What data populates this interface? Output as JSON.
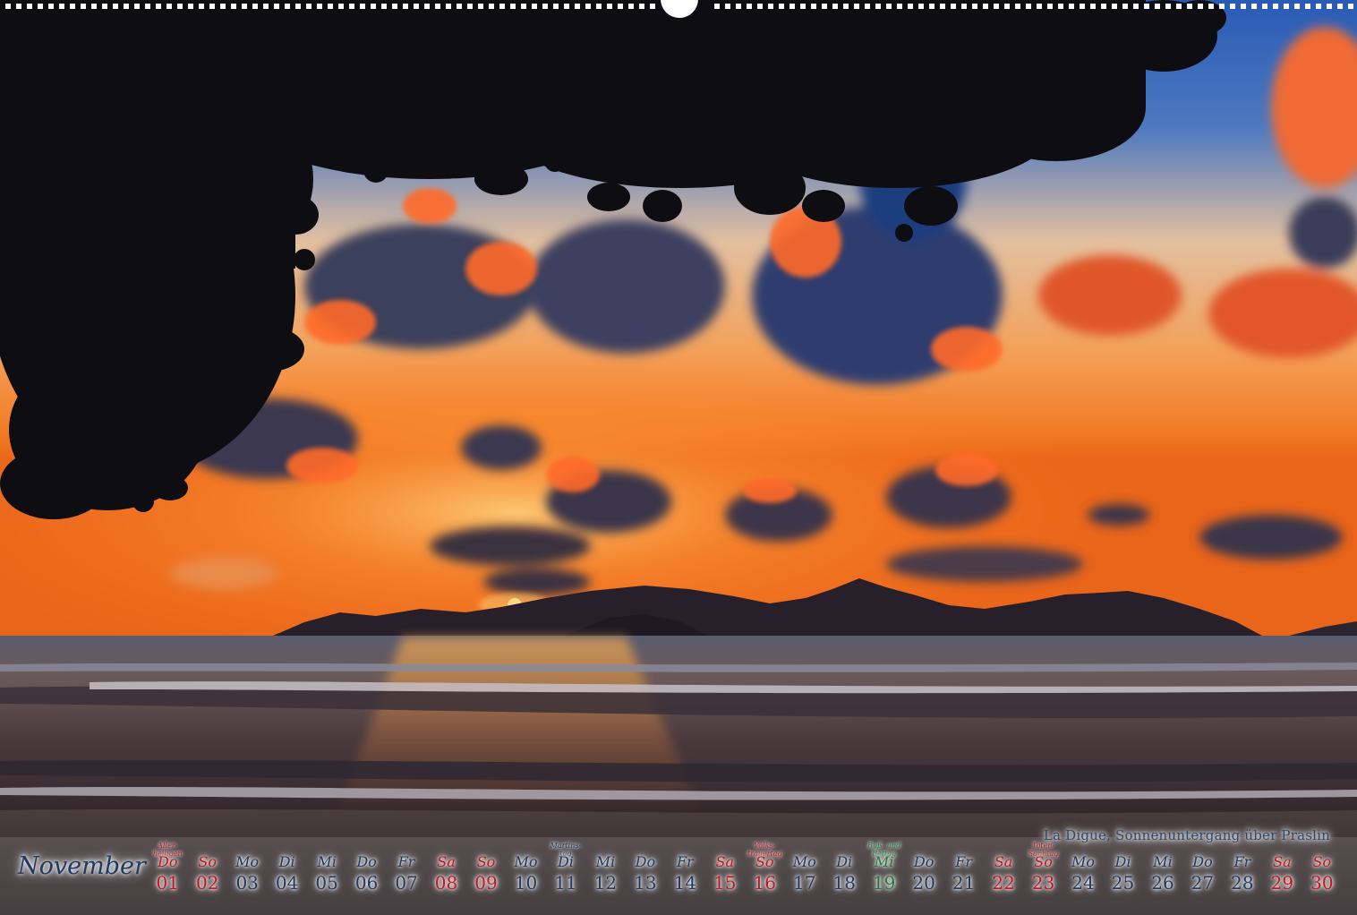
{
  "caption": "La Digue, Sonnenuntergang über Praslin",
  "month": "November",
  "colors": {
    "weekday": "#1f3a63",
    "holiday": "#c8141e",
    "observance": "#1c7a3a"
  },
  "days": [
    {
      "wd": "Do",
      "num": "01",
      "hol": "Aller-\nheiligen",
      "type": "red"
    },
    {
      "wd": "So",
      "num": "02",
      "hol": "",
      "type": "red"
    },
    {
      "wd": "Mo",
      "num": "03",
      "hol": "",
      "type": "blue"
    },
    {
      "wd": "Di",
      "num": "04",
      "hol": "",
      "type": "blue"
    },
    {
      "wd": "Mi",
      "num": "05",
      "hol": "",
      "type": "blue"
    },
    {
      "wd": "Do",
      "num": "06",
      "hol": "",
      "type": "blue"
    },
    {
      "wd": "Fr",
      "num": "07",
      "hol": "",
      "type": "blue"
    },
    {
      "wd": "Sa",
      "num": "08",
      "hol": "",
      "type": "red"
    },
    {
      "wd": "So",
      "num": "09",
      "hol": "",
      "type": "red"
    },
    {
      "wd": "Mo",
      "num": "10",
      "hol": "",
      "type": "blue"
    },
    {
      "wd": "Di",
      "num": "11",
      "hol": "Martins-\ntag",
      "type": "blue"
    },
    {
      "wd": "Mi",
      "num": "12",
      "hol": "",
      "type": "blue"
    },
    {
      "wd": "Do",
      "num": "13",
      "hol": "",
      "type": "blue"
    },
    {
      "wd": "Fr",
      "num": "14",
      "hol": "",
      "type": "blue"
    },
    {
      "wd": "Sa",
      "num": "15",
      "hol": "",
      "type": "red"
    },
    {
      "wd": "So",
      "num": "16",
      "hol": "Volks-\ntrauertag",
      "type": "red"
    },
    {
      "wd": "Mo",
      "num": "17",
      "hol": "",
      "type": "blue"
    },
    {
      "wd": "Di",
      "num": "18",
      "hol": "",
      "type": "blue"
    },
    {
      "wd": "Mi",
      "num": "19",
      "hol": "Buß- und\nBettag",
      "type": "green"
    },
    {
      "wd": "Do",
      "num": "20",
      "hol": "",
      "type": "blue"
    },
    {
      "wd": "Fr",
      "num": "21",
      "hol": "",
      "type": "blue"
    },
    {
      "wd": "Sa",
      "num": "22",
      "hol": "",
      "type": "red"
    },
    {
      "wd": "So",
      "num": "23",
      "hol": "Toten-\nSonntag",
      "type": "red"
    },
    {
      "wd": "Mo",
      "num": "24",
      "hol": "",
      "type": "blue"
    },
    {
      "wd": "Di",
      "num": "25",
      "hol": "",
      "type": "blue"
    },
    {
      "wd": "Mi",
      "num": "26",
      "hol": "",
      "type": "blue"
    },
    {
      "wd": "Do",
      "num": "27",
      "hol": "",
      "type": "blue"
    },
    {
      "wd": "Fr",
      "num": "28",
      "hol": "",
      "type": "blue"
    },
    {
      "wd": "Sa",
      "num": "29",
      "hol": "",
      "type": "red"
    },
    {
      "wd": "So",
      "num": "30",
      "hol": "",
      "type": "red"
    }
  ]
}
